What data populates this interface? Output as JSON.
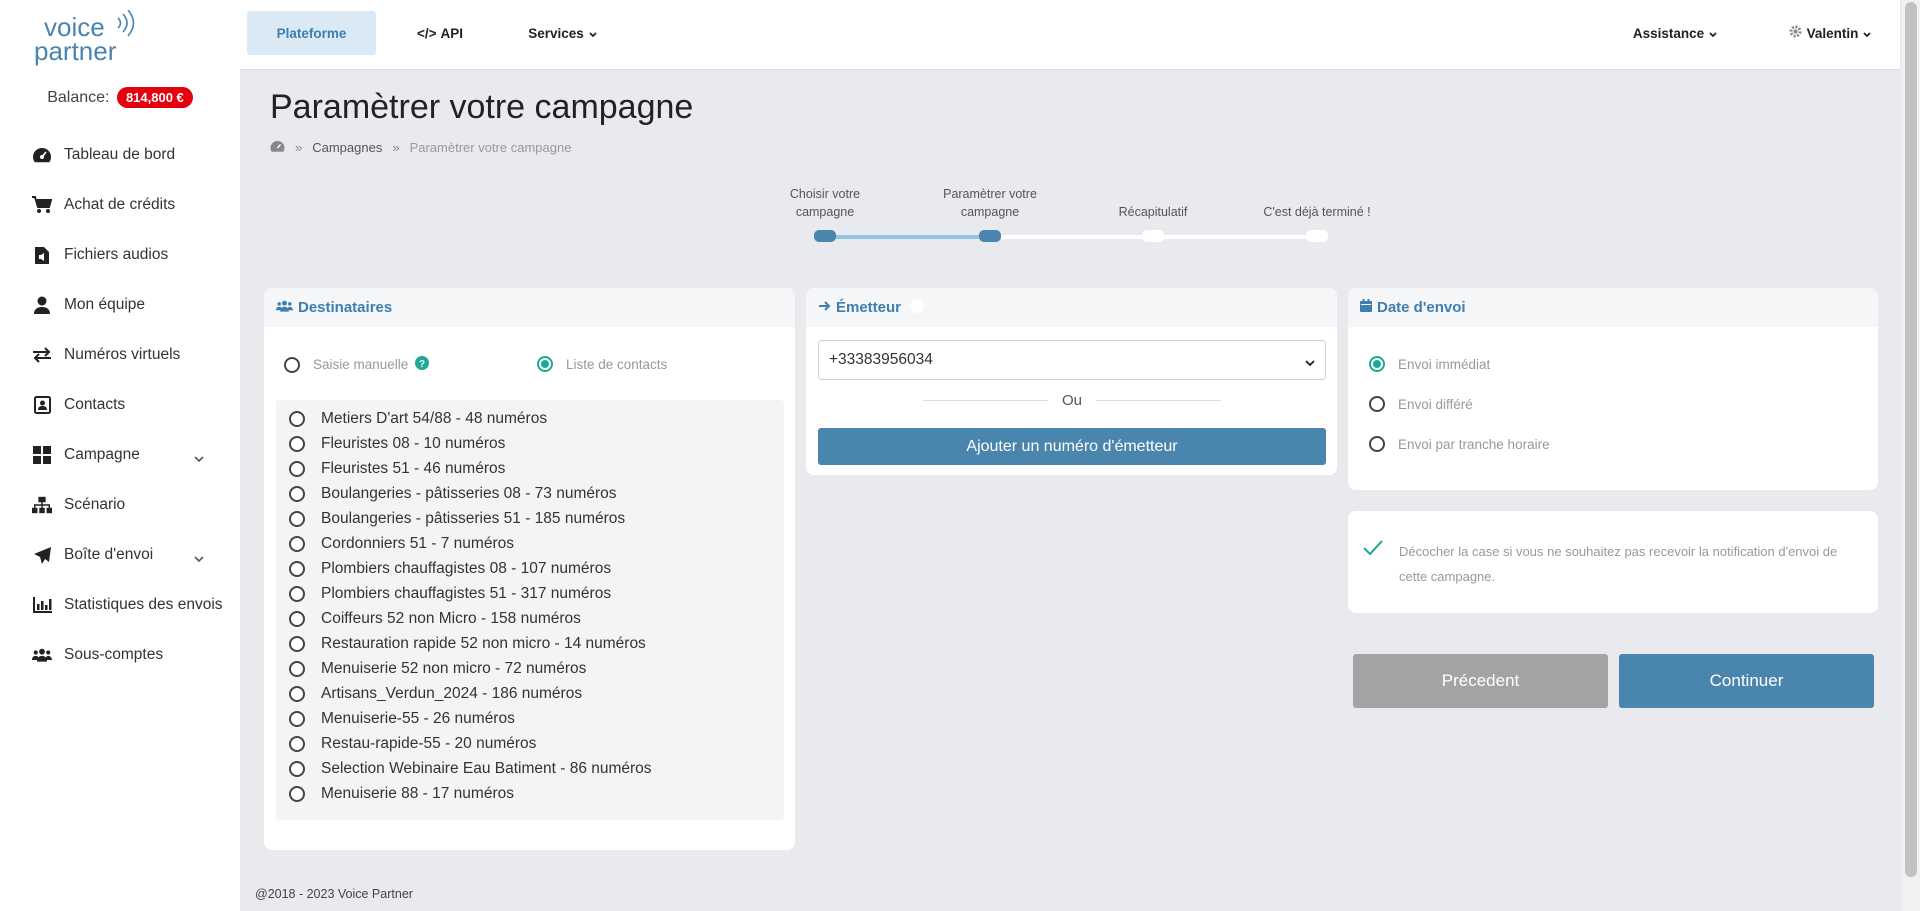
{
  "brand": {
    "logo_line1": "voice",
    "logo_line2": "partner"
  },
  "balance": {
    "label": "Balance:",
    "amount": "814,800 €"
  },
  "sidebar": {
    "items": [
      {
        "label": "Tableau de bord",
        "icon": "dashboard-icon"
      },
      {
        "label": "Achat de crédits",
        "icon": "cart-icon"
      },
      {
        "label": "Fichiers audios",
        "icon": "audio-file-icon"
      },
      {
        "label": "Mon équipe",
        "icon": "user-icon"
      },
      {
        "label": "Numéros virtuels",
        "icon": "exchange-icon"
      },
      {
        "label": "Contacts",
        "icon": "contact-card-icon"
      },
      {
        "label": "Campagne",
        "icon": "grid-icon"
      },
      {
        "label": "Scénario",
        "icon": "sitemap-icon"
      },
      {
        "label": "Boîte d'envoi",
        "icon": "paper-plane-icon"
      },
      {
        "label": "Statistiques des envois",
        "icon": "bar-chart-icon"
      },
      {
        "label": "Sous-comptes",
        "icon": "users-icon"
      }
    ]
  },
  "topbar": {
    "plateforme": "Plateforme",
    "api": "API",
    "services": "Services",
    "assistance": "Assistance",
    "user": "Valentin"
  },
  "page": {
    "title": "Paramètrer votre campagne",
    "breadcrumb": [
      "Campagnes",
      "Paramètrer votre campagne"
    ]
  },
  "steps": [
    {
      "line1": "Choisir votre",
      "line2": "campagne",
      "state": "done"
    },
    {
      "line1": "Paramètrer votre",
      "line2": "campagne",
      "state": "current"
    },
    {
      "line1": "",
      "line2": "Récapitulatif",
      "state": "todo"
    },
    {
      "line1": "",
      "line2": "C'est déjà terminé !",
      "state": "todo"
    }
  ],
  "destinataires": {
    "title": "Destinataires",
    "mode_manual": "Saisie manuelle",
    "mode_list": "Liste de contacts",
    "selected_mode": "Liste de contacts",
    "contacts": [
      "Metiers D'art 54/88 - 48 numéros",
      "Fleuristes 08 - 10 numéros",
      "Fleuristes 51 - 46 numéros",
      "Boulangeries - pâtisseries 08 - 73 numéros",
      "Boulangeries - pâtisseries 51 - 185 numéros",
      "Cordonniers 51 - 7 numéros",
      "Plombiers chauffagistes 08 - 107 numéros",
      "Plombiers chauffagistes 51 - 317 numéros",
      "Coiffeurs 52 non Micro - 158 numéros",
      "Restauration rapide 52 non micro - 14 numéros",
      "Menuiserie 52 non micro - 72 numéros",
      "Artisans_Verdun_2024 - 186 numéros",
      "Menuiserie-55 - 26 numéros",
      "Restau-rapide-55 - 20 numéros",
      "Selection Webinaire Eau Batiment - 86 numéros",
      "Menuiserie 88 - 17 numéros"
    ]
  },
  "emetteur": {
    "title": "Émetteur",
    "selected_number": "+33383956034",
    "or_label": "Ou",
    "add_button": "Ajouter un numéro d'émetteur"
  },
  "date_envoi": {
    "title": "Date d'envoi",
    "options": [
      "Envoi immédiat",
      "Envoi différé",
      "Envoi par tranche horaire"
    ],
    "selected": "Envoi immédiat"
  },
  "notification": {
    "checked": true,
    "text": "Décocher la case si vous ne souhaitez pas recevoir la notification d'envoi de cette campagne."
  },
  "actions": {
    "previous": "Précedent",
    "continue": "Continuer"
  },
  "footer": {
    "copyright": "@2018 - 2023 Voice Partner"
  },
  "colors": {
    "accent": "#4a85ad",
    "radio_on": "#1fa896",
    "balance_badge": "#e3000f",
    "previous_button": "#a3a3a3"
  }
}
